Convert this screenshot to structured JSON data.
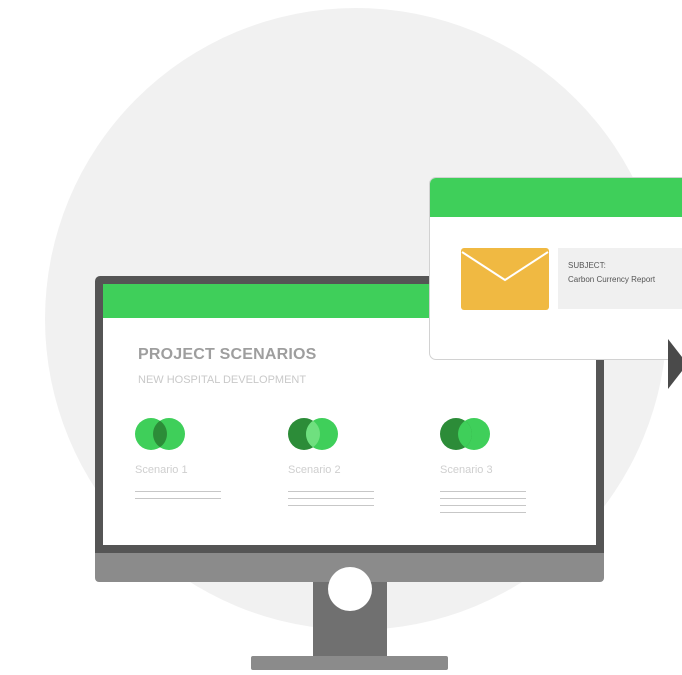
{
  "colors": {
    "accent_green": "#3fcf5a",
    "dark_green": "#2c8c38",
    "envelope": "#f0b942",
    "monitor_bezel": "#555555"
  },
  "screen": {
    "title": "PROJECT SCENARIOS",
    "subtitle": "NEW HOSPITAL DEVELOPMENT",
    "scenarios": [
      {
        "label": "Scenario 1",
        "icon": "venn-icon"
      },
      {
        "label": "Scenario 2",
        "icon": "venn-icon"
      },
      {
        "label": "Scenario 3",
        "icon": "venn-icon"
      }
    ]
  },
  "email": {
    "icon": "envelope-icon",
    "subject_label": "SUBJECT:",
    "subject_value": "Carbon Currency Report"
  },
  "cursor": {
    "icon": "cursor-arrow-icon"
  }
}
